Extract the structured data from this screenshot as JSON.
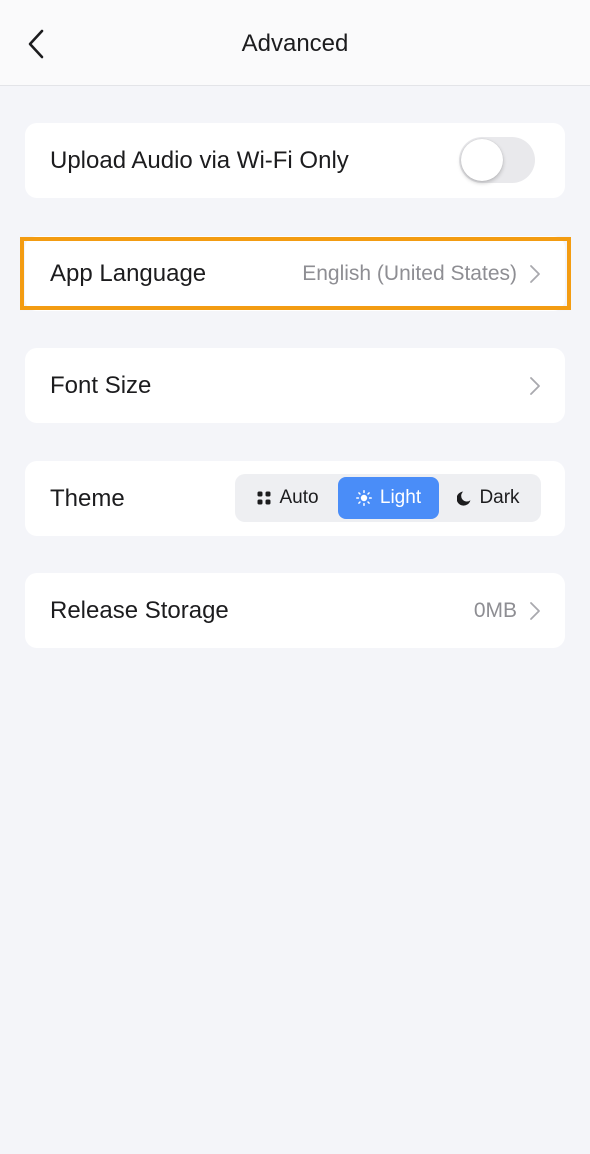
{
  "nav": {
    "back_icon": "chevron-left-icon",
    "title": "Advanced"
  },
  "settings": {
    "upload_audio": {
      "label": "Upload Audio via Wi-Fi Only",
      "enabled": false
    },
    "app_language": {
      "label": "App Language",
      "value": "English (United States)"
    },
    "font_size": {
      "label": "Font Size"
    },
    "theme": {
      "label": "Theme",
      "options": [
        {
          "label": "Auto",
          "icon": "grid-dots-icon"
        },
        {
          "label": "Light",
          "icon": "sun-icon"
        },
        {
          "label": "Dark",
          "icon": "moon-icon"
        }
      ],
      "selected": "Light"
    },
    "release_storage": {
      "label": "Release Storage",
      "value": "0MB"
    }
  },
  "colors": {
    "background": "#f4f5f9",
    "card": "#ffffff",
    "accent": "#4a8df8",
    "highlight": "#f39c12",
    "secondary_text": "#8e8e93"
  }
}
